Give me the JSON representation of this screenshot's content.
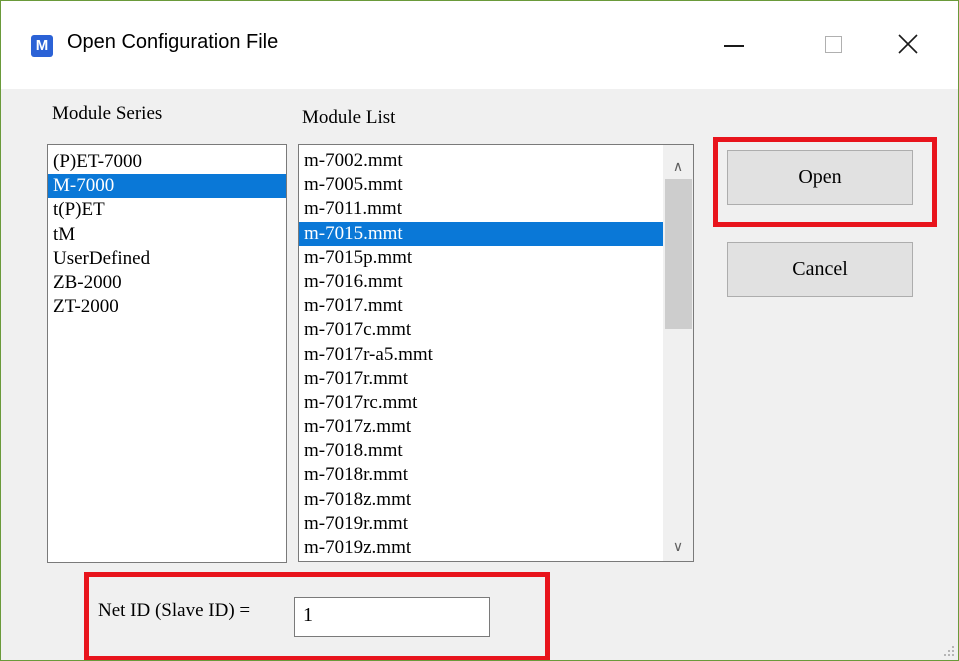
{
  "window": {
    "title": "Open Configuration File",
    "app_icon_letter": "M",
    "accent_color": "#0a78d7",
    "highlight_color": "#e8141c"
  },
  "module_series": {
    "label": "Module Series",
    "selected": "M-7000",
    "items": [
      "(P)ET-7000",
      "M-7000",
      "t(P)ET",
      "tM",
      "UserDefined",
      "ZB-2000",
      "ZT-2000"
    ]
  },
  "module_list": {
    "label": "Module List",
    "selected": "m-7015.mmt",
    "items": [
      "m-7002.mmt",
      "m-7005.mmt",
      "m-7011.mmt",
      "m-7015.mmt",
      "m-7015p.mmt",
      "m-7016.mmt",
      "m-7017.mmt",
      "m-7017c.mmt",
      "m-7017r-a5.mmt",
      "m-7017r.mmt",
      "m-7017rc.mmt",
      "m-7017z.mmt",
      "m-7018.mmt",
      "m-7018r.mmt",
      "m-7018z.mmt",
      "m-7019r.mmt",
      "m-7019z.mmt"
    ]
  },
  "buttons": {
    "open_label": "Open",
    "cancel_label": "Cancel"
  },
  "net_id": {
    "label": "Net ID (Slave ID) =",
    "value": "1"
  }
}
